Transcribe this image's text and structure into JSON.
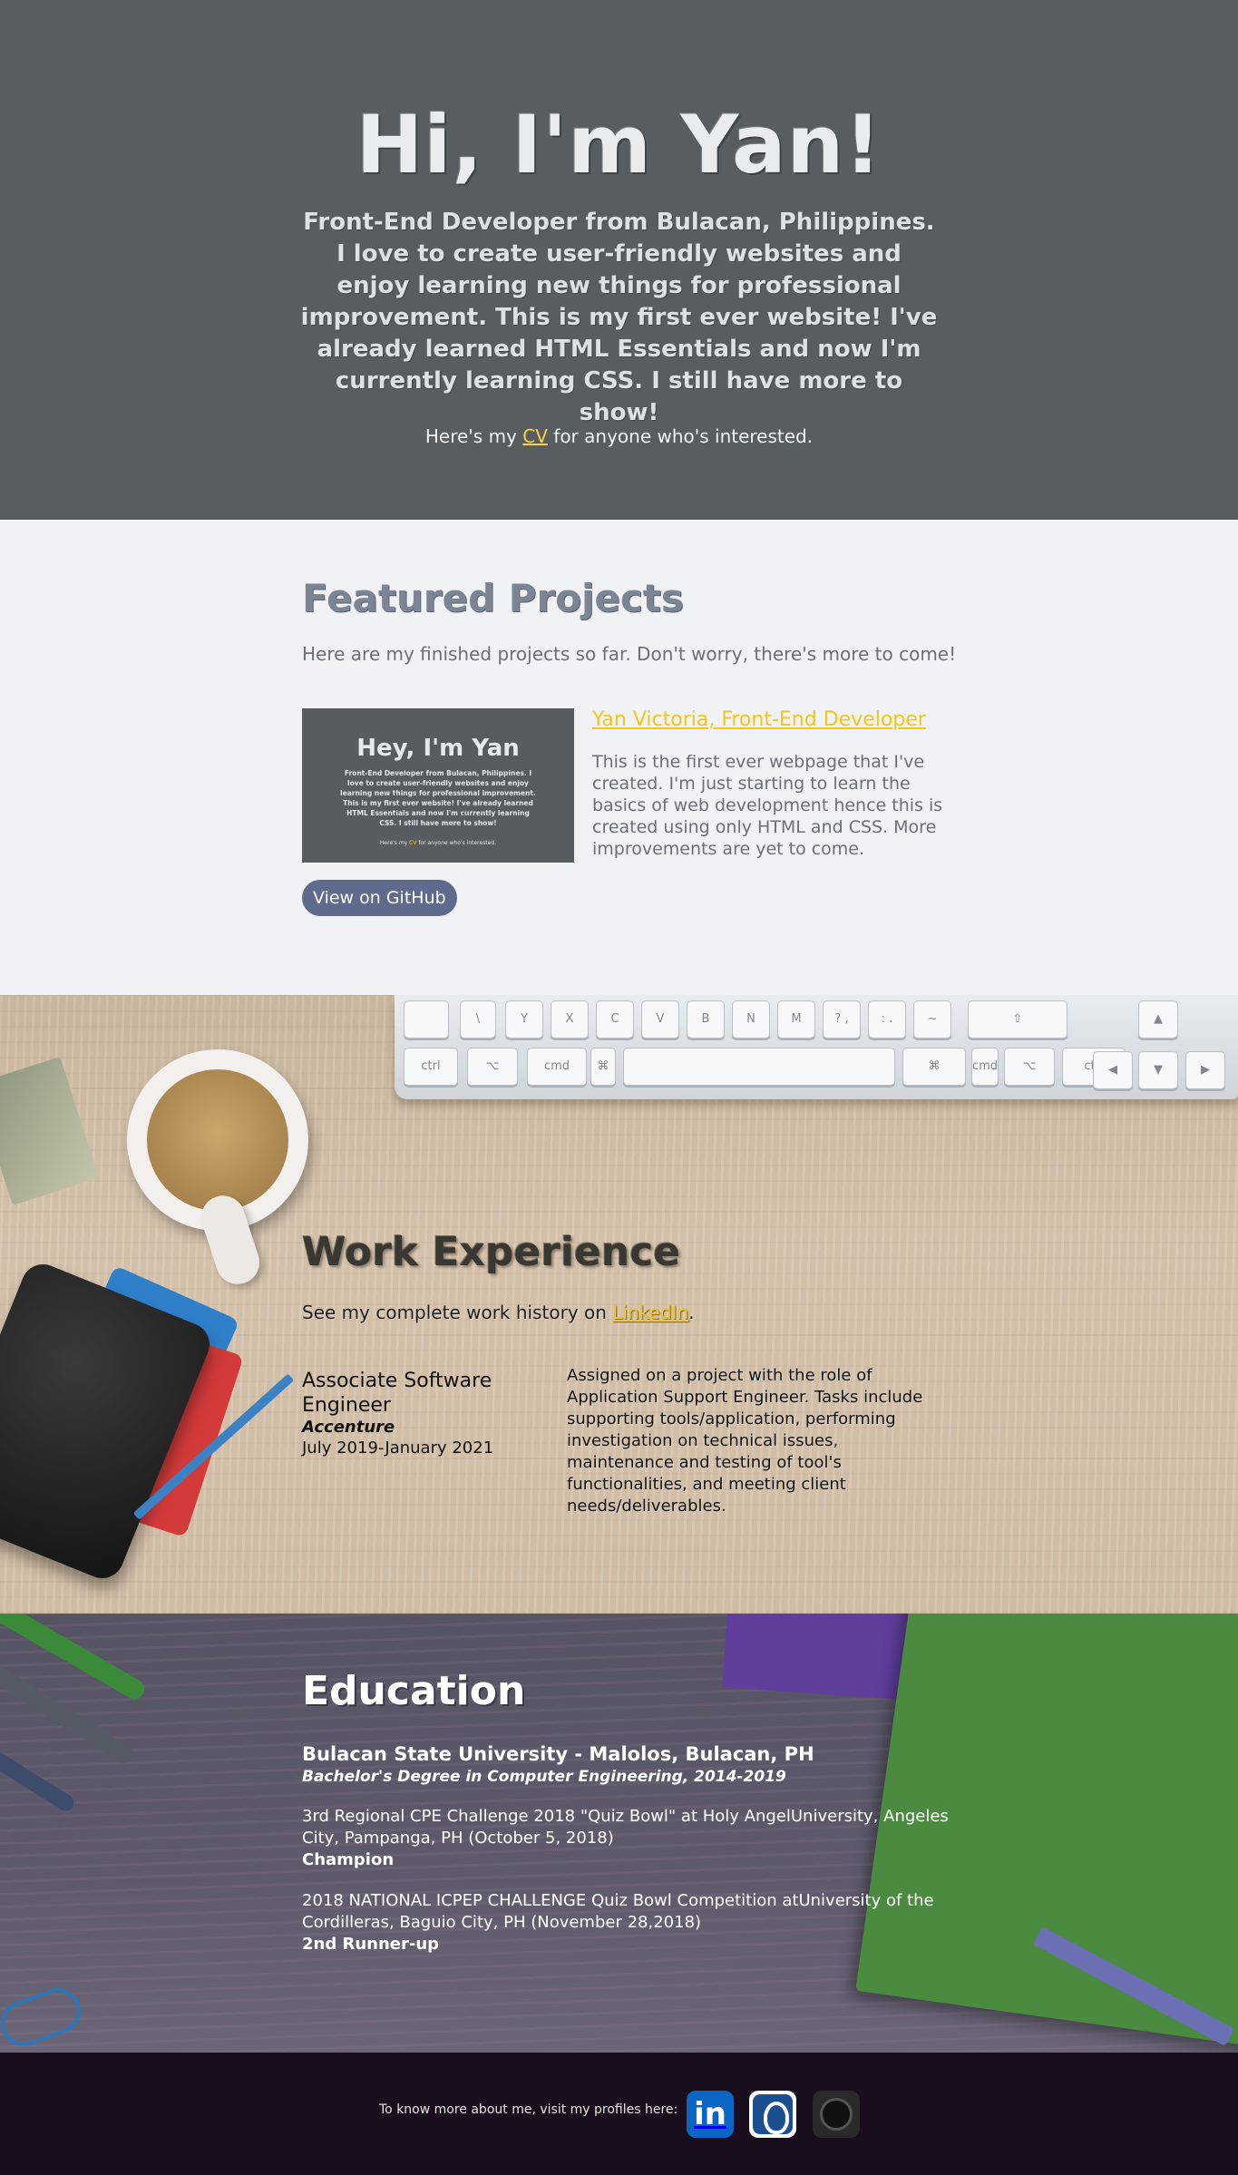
{
  "hero": {
    "title": "Hi, I'm Yan!",
    "bio": "Front-End Developer from Bulacan, Philippines. I love to create user-friendly websites and enjoy learning new things for professional improvement. This is my first ever website! I've already learned HTML Essentials and now I'm currently learning CSS. I still have more to show!",
    "cv_prefix": "Here's my ",
    "cv_link": "CV",
    "cv_suffix": " for anyone who's interested."
  },
  "featured": {
    "title": "Featured Projects",
    "subtitle": "Here are my finished projects so far. Don't worry, there's more to come!",
    "project": {
      "thumb_title": "Hey, I'm Yan",
      "thumb_bio": "Front-End Developer from Bulacan, Philippines. I love to create user-friendly websites and enjoy learning new things for professional improvement. This is my first ever website! I've already learned HTML Essentials and now I'm currently learning CSS. I still have more to show!",
      "thumb_cv_prefix": "Here's my ",
      "thumb_cv_link": "CV",
      "thumb_cv_suffix": " for anyone who's interested.",
      "link": "Yan Victoria, Front-End Developer",
      "description": "This is the first ever webpage that I've created. I'm just starting to learn the basics of web development hence this is created using only HTML and CSS. More improvements are yet to come.",
      "button": "View on GitHub"
    }
  },
  "keyboard": {
    "row1": [
      "",
      "\\",
      "Y",
      "X",
      "C",
      "V",
      "B",
      "N",
      "M",
      "? ,",
      ": .",
      "~ ",
      "⇧",
      "▲"
    ],
    "row2": [
      "ctrl",
      "⌥",
      "cmd",
      "⌘",
      "",
      "⌘",
      "cmd",
      "⌥",
      "ctrl",
      "◀",
      "▼",
      "▶"
    ]
  },
  "work": {
    "title": "Work Experience",
    "subtitle_prefix": "See my complete work history on ",
    "subtitle_link": "LinkedIn",
    "subtitle_suffix": ".",
    "job": {
      "title": "Associate Software Engineer",
      "company": "Accenture",
      "dates": "July 2019-January 2021",
      "description": "Assigned on a project with the role of Application Support Engineer. Tasks include supporting tools/application, performing investigation on technical issues, maintenance and testing of tool's functionalities, and meeting client needs/deliverables."
    }
  },
  "education": {
    "title": "Education",
    "school": "Bulacan State University - Malolos, Bulacan, PH",
    "degree": "Bachelor's Degree in Computer Engineering, 2014-2019",
    "awards": [
      {
        "text": "3rd Regional CPE Challenge 2018 \"Quiz Bowl\" at Holy AngelUniversity, Angeles City, Pampanga, PH (October 5, 2018)",
        "place": "Champion"
      },
      {
        "text": "2018 NATIONAL ICPEP CHALLENGE Quiz Bowl Competition atUniversity of the Cordilleras, Baguio City, PH (November 28,2018)",
        "place": "2nd Runner-up"
      }
    ]
  },
  "footer": {
    "text": "To know more about me, visit my profiles here:",
    "icons": [
      "linkedin-icon",
      "freecodecamp-icon",
      "github-icon"
    ],
    "linkedin_glyph": "in"
  },
  "colors": {
    "hero_bg": "#575d60",
    "featured_bg": "#f1f2f6",
    "link_yellow": "#f5c518",
    "button_bg": "#5f6b8c",
    "footer_bg": "#190d1e",
    "linkedin_blue": "#0a66c2"
  }
}
